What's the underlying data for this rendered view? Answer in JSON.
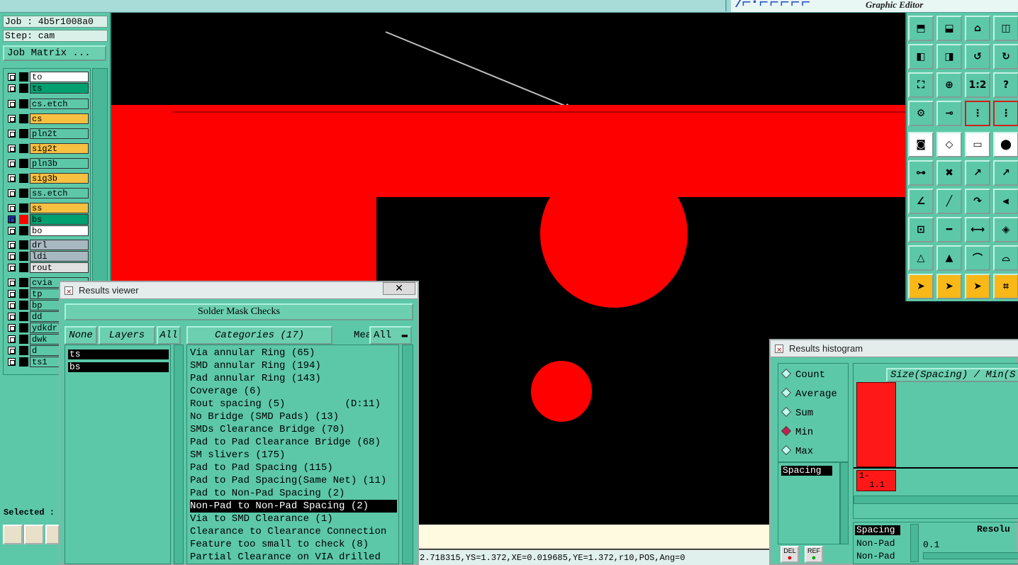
{
  "brand": {
    "subtitle": "Graphic Editor"
  },
  "left_panel": {
    "job": "Job : 4b5r1008a0",
    "step": "Step: cam",
    "job_matrix": "Job Matrix ...",
    "layers": [
      {
        "name": "to",
        "color": "#ffffff"
      },
      {
        "name": "ts",
        "color": "#00a070"
      },
      {
        "name": "cs.etch",
        "color": "#5cc8a8"
      },
      {
        "name": "cs",
        "color": "#f8c040"
      },
      {
        "name": "pln2t",
        "color": "#5cc8a8"
      },
      {
        "name": "sig2t",
        "color": "#f8c040"
      },
      {
        "name": "pln3b",
        "color": "#5cc8a8"
      },
      {
        "name": "sig3b",
        "color": "#f8c040"
      },
      {
        "name": "ss.etch",
        "color": "#5cc8a8"
      },
      {
        "name": "ss",
        "color": "#f8c040"
      },
      {
        "name": "bs",
        "color": "#00a070"
      },
      {
        "name": "bo",
        "color": "#ffffff"
      },
      {
        "name": "drl",
        "color": "#a8b8c0"
      },
      {
        "name": "ldi",
        "color": "#a8b8c0"
      },
      {
        "name": "rout",
        "color": "#e0e0e0"
      },
      {
        "name": "cvia",
        "color": "#5cc8a8"
      },
      {
        "name": "tp",
        "color": "#5cc8a8"
      },
      {
        "name": "bp",
        "color": "#5cc8a8"
      },
      {
        "name": "dd",
        "color": "#5cc8a8"
      },
      {
        "name": "ydkdrl",
        "color": "#5cc8a8"
      },
      {
        "name": "dwk",
        "color": "#5cc8a8"
      },
      {
        "name": "d",
        "color": "#5cc8a8"
      },
      {
        "name": "ts1",
        "color": "#5cc8a8"
      }
    ],
    "selected_label": "Selected :"
  },
  "status_line": "2.718315,YS=1.372,XE=0.019685,YE=1.372,r10,POS,Ang=0",
  "palette": {
    "one_to_two": "1:2",
    "question": "?"
  },
  "results_viewer": {
    "title": "Results viewer",
    "close": "✕",
    "panel_title": "Solder Mask Checks",
    "none_btn": "None",
    "layers_btn": "Layers",
    "all_btn": "All",
    "categories_btn": "Categories (17)",
    "meas_label": "Meas:",
    "meas_value": "All",
    "selected_layers": [
      "ts",
      "bs"
    ],
    "categories": [
      "Via annular Ring (65)",
      "SMD annular Ring (194)",
      "Pad annular Ring (143)",
      "Coverage (6)",
      "Rout spacing (5)          (D:11)",
      "No Bridge (SMD Pads) (13)",
      "SMDs Clearance Bridge (70)",
      "Pad to Pad Clearance Bridge (68)",
      "SM slivers (175)",
      "Pad to Pad Spacing (115)",
      "Pad to Pad Spacing(Same Net) (11)",
      "Pad to Non-Pad Spacing (2)",
      "Non-Pad to Non-Pad Spacing (2)",
      "Via to SMD Clearance (1)",
      "Clearance to Clearance Connection",
      "Feature too small to check (8)",
      "Partial Clearance on VIA drilled"
    ],
    "selected_index": 12
  },
  "histogram": {
    "title": "Results histogram",
    "header": "Size(Spacing) / Min(S",
    "radios": [
      "Count",
      "Average",
      "Sum",
      "Min",
      "Max"
    ],
    "selected_radio": "Min",
    "list_top": "Spacing",
    "list_bottom": [
      "Spacing",
      "Non-Pad",
      "Non-Pad"
    ],
    "bar_count": "1",
    "bar_label": "1-\n  1.1",
    "bar_fraction": 1.0,
    "result_label": "Resolu",
    "result_value": "0.1",
    "del_btn": "DEL",
    "ref_btn": "REF"
  }
}
